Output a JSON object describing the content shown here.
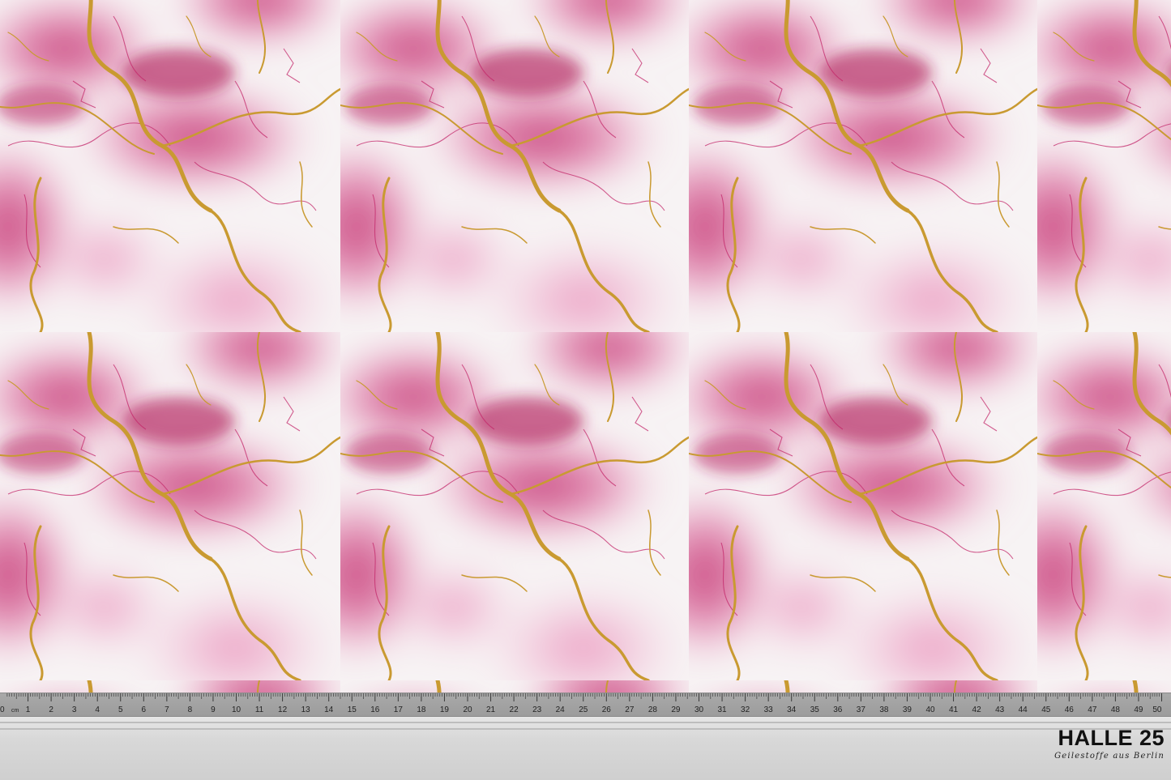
{
  "colors": {
    "marble_base": "#f6f2f3",
    "pink_light": "#ea9cc2",
    "pink_mid": "#d6588f",
    "pink_deep": "#b41f5e",
    "vein_gold": "#c9982f",
    "ruler_grey": "#a3a3a3"
  },
  "ruler": {
    "start_label": "0",
    "unit": "cm",
    "labels": [
      "1",
      "2",
      "3",
      "4",
      "5",
      "6",
      "7",
      "8",
      "9",
      "10",
      "11",
      "12",
      "13",
      "14",
      "15",
      "16",
      "17",
      "18",
      "19",
      "20",
      "21",
      "22",
      "23",
      "24",
      "25",
      "26",
      "27",
      "28",
      "29",
      "30",
      "31",
      "32",
      "33",
      "34",
      "35",
      "36",
      "37",
      "38",
      "39",
      "40",
      "41",
      "42",
      "43",
      "44",
      "45",
      "46",
      "47",
      "48",
      "49",
      "50"
    ]
  },
  "brand": {
    "name": "HALLE 25",
    "tagline": "Geilestoffe aus Berlin"
  }
}
